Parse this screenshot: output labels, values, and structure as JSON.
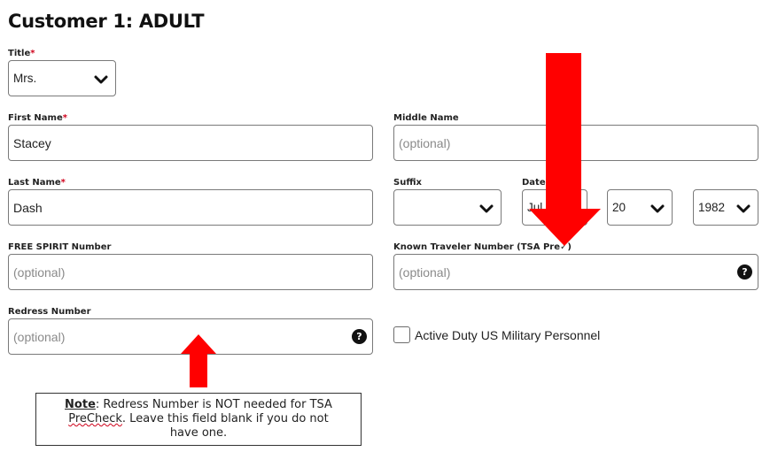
{
  "heading": "Customer 1: ADULT",
  "required_mark": "*",
  "title": {
    "label": "Title",
    "value": "Mrs."
  },
  "first_name": {
    "label": "First Name",
    "value": "Stacey"
  },
  "middle_name": {
    "label": "Middle Name",
    "placeholder": "(optional)"
  },
  "last_name": {
    "label": "Last Name",
    "value": "Dash"
  },
  "suffix": {
    "label": "Suffix",
    "value": ""
  },
  "dob": {
    "label": "Date o",
    "month": "Jul",
    "day": "20",
    "year": "1982"
  },
  "free_spirit": {
    "label": "FREE SPIRIT Number",
    "placeholder": "(optional)"
  },
  "ktn": {
    "label": "Known Traveler Number (TSA Pre✓)",
    "placeholder": "(optional)",
    "help_glyph": "?"
  },
  "redress": {
    "label": "Redress Number",
    "placeholder": "(optional)",
    "help_glyph": "?"
  },
  "military": {
    "label": "Active Duty US Military Personnel",
    "checked": false
  },
  "note": {
    "word": "Note",
    "line1": ": Redress Number is NOT needed for TSA",
    "precheck": "PreCheck",
    "line2": ". Leave this field blank if you do not",
    "line3": "have one."
  },
  "colors": {
    "accent_red": "#ff0000",
    "required_red": "#d0021b",
    "border": "#7a7a7a"
  }
}
